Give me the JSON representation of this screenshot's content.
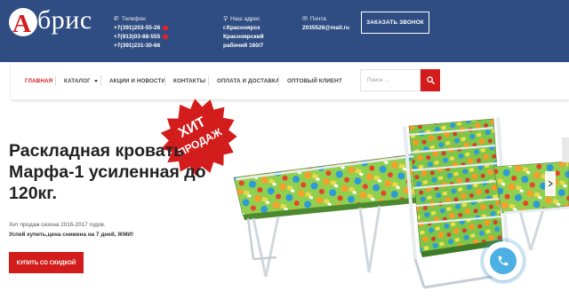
{
  "brand": {
    "name": "Абрис",
    "colors": {
      "header_bg": "#2f4d82",
      "accent": "#d31c1c"
    }
  },
  "contacts": {
    "phone": {
      "heading": "Телефон",
      "icon": "phone-icon",
      "numbers": [
        "+7(391)203-55-26",
        "+7(913)03-88-555",
        "+7(391)231-30-66"
      ]
    },
    "address": {
      "heading": "Наш адрес",
      "icon": "map-pin-icon",
      "lines": [
        "г.Красноярск",
        "Красноярский",
        "рабочий 160/7"
      ]
    },
    "mail": {
      "heading": "Почта",
      "icon": "envelope-icon",
      "email": "2035526@mail.ru"
    },
    "call_button": "ЗАКАЗАТЬ ЗВОНОК"
  },
  "nav": {
    "items": [
      "ГЛАВНАЯ",
      "КАТАЛОГ",
      "АКЦИИ И НОВОСТИ",
      "КОНТАКТЫ",
      "ОПЛАТА И ДОСТАВКА",
      "ОПТОВЫЙ КЛИЕНТ"
    ],
    "active": "ГЛАВНАЯ",
    "search_placeholder": "Поиск …"
  },
  "hero": {
    "badge_line1": "ХИТ",
    "badge_line2": "ПРОДАЖ",
    "title_lines": [
      "Раскладная кровать",
      "Марфа-1 усиленная до",
      "120кг."
    ],
    "subtitle": "Хит продаж сезона 2016-2017 годов.",
    "promo": "Успей купить,цена снижена на 7 дней, ЖМИ!",
    "button": "КУПИТЬ СО СКИДКОЙ"
  }
}
